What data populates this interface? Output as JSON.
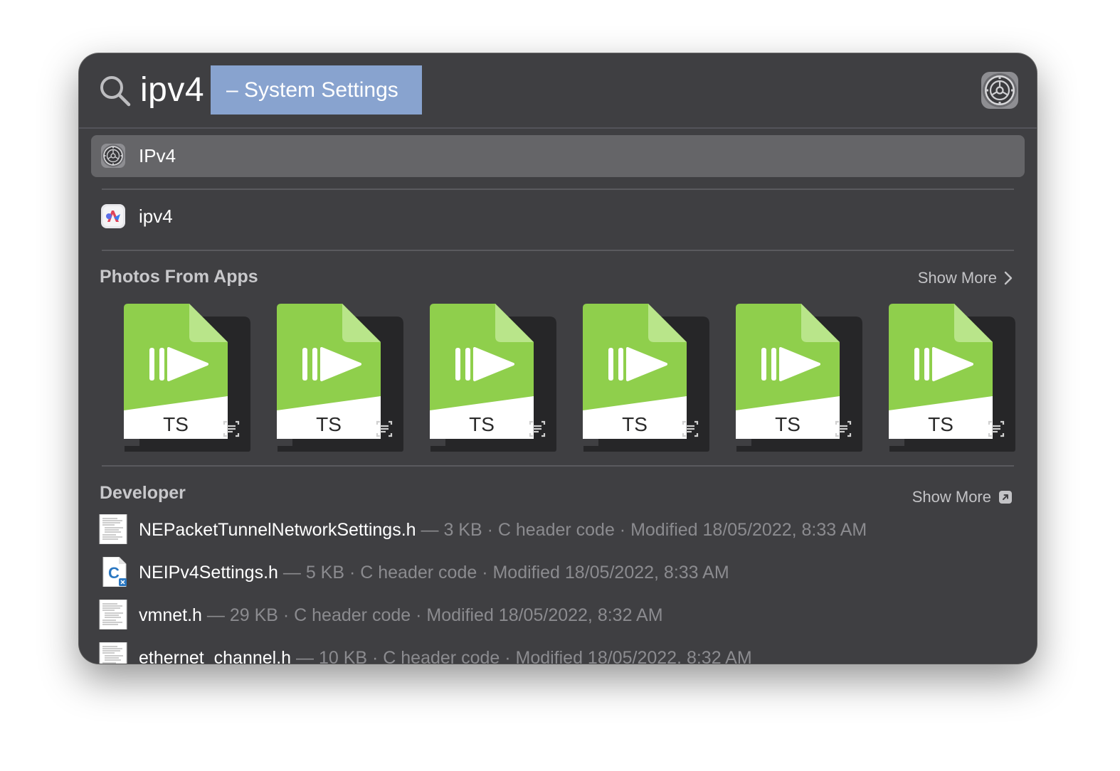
{
  "search": {
    "query": "ipv4",
    "completion": "– System Settings"
  },
  "results": [
    {
      "label": "IPv4",
      "icon": "system-settings-icon",
      "selected": true
    },
    {
      "label": "ipv4",
      "icon": "feedback-assistant-icon",
      "selected": false
    }
  ],
  "photos": {
    "title": "Photos From Apps",
    "show_more": "Show More",
    "items": [
      {
        "type_label": "TS"
      },
      {
        "type_label": "TS"
      },
      {
        "type_label": "TS"
      },
      {
        "type_label": "TS"
      },
      {
        "type_label": "TS"
      },
      {
        "type_label": "TS"
      }
    ]
  },
  "developer": {
    "title": "Developer",
    "show_more": "Show More",
    "items": [
      {
        "name": "NEPacketTunnelNetworkSettings.h",
        "meta": " — 3 KB · C header code · Modified 18/05/2022, 8:33 AM",
        "icon": "document-icon"
      },
      {
        "name": "NEIPv4Settings.h",
        "meta": " — 5 KB · C header code · Modified 18/05/2022, 8:33 AM",
        "icon": "c-header-icon"
      },
      {
        "name": "vmnet.h",
        "meta": " — 29 KB · C header code · Modified 18/05/2022, 8:32 AM",
        "icon": "document-icon"
      },
      {
        "name": "ethernet_channel.h",
        "meta": " — 10 KB · C header code · Modified 18/05/2022, 8:32 AM",
        "icon": "document-icon"
      }
    ]
  },
  "colors": {
    "window_bg": "#3f3f42",
    "selection": "#656568",
    "completion_highlight": "#88a3cf",
    "ts_green": "#8fcf4c"
  }
}
